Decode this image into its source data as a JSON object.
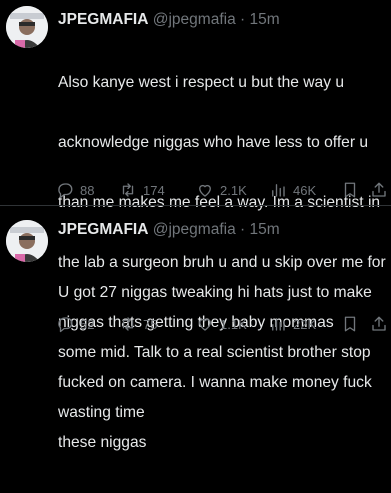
{
  "tweets": [
    {
      "author_name": "JPEGMAFIA",
      "handle": "@jpegmafia",
      "separator": "·",
      "time": "15m",
      "lines": [
        "Also kanye west i respect u but the way u",
        "acknowledge niggas who have less to offer u",
        "than me makes me feel a way. Im a scientist in",
        "the lab a surgeon bruh u and u skip over me for",
        "niggas thats getting they baby mommas",
        "fucked on camera. I wanna make money fuck",
        "these niggas"
      ],
      "stats": {
        "replies": "88",
        "reposts": "174",
        "likes": "2.1K",
        "views": "46K"
      }
    },
    {
      "author_name": "JPEGMAFIA",
      "handle": "@jpegmafia",
      "separator": "·",
      "time": "15m",
      "lines": [
        "U got 27 niggas tweaking hi hats just to make",
        "some mid. Talk to a real scientist brother stop",
        "wasting time"
      ],
      "stats": {
        "replies": "52",
        "reposts": "75",
        "likes": "1.1K",
        "views": "22K"
      }
    }
  ],
  "icons": [
    "reply-icon",
    "repost-icon",
    "like-icon",
    "views-icon",
    "bookmark-icon",
    "share-icon"
  ],
  "colors": {
    "background": "#000000",
    "text": "#e7e9ea",
    "muted": "#71767b",
    "divider": "#2f3336"
  }
}
